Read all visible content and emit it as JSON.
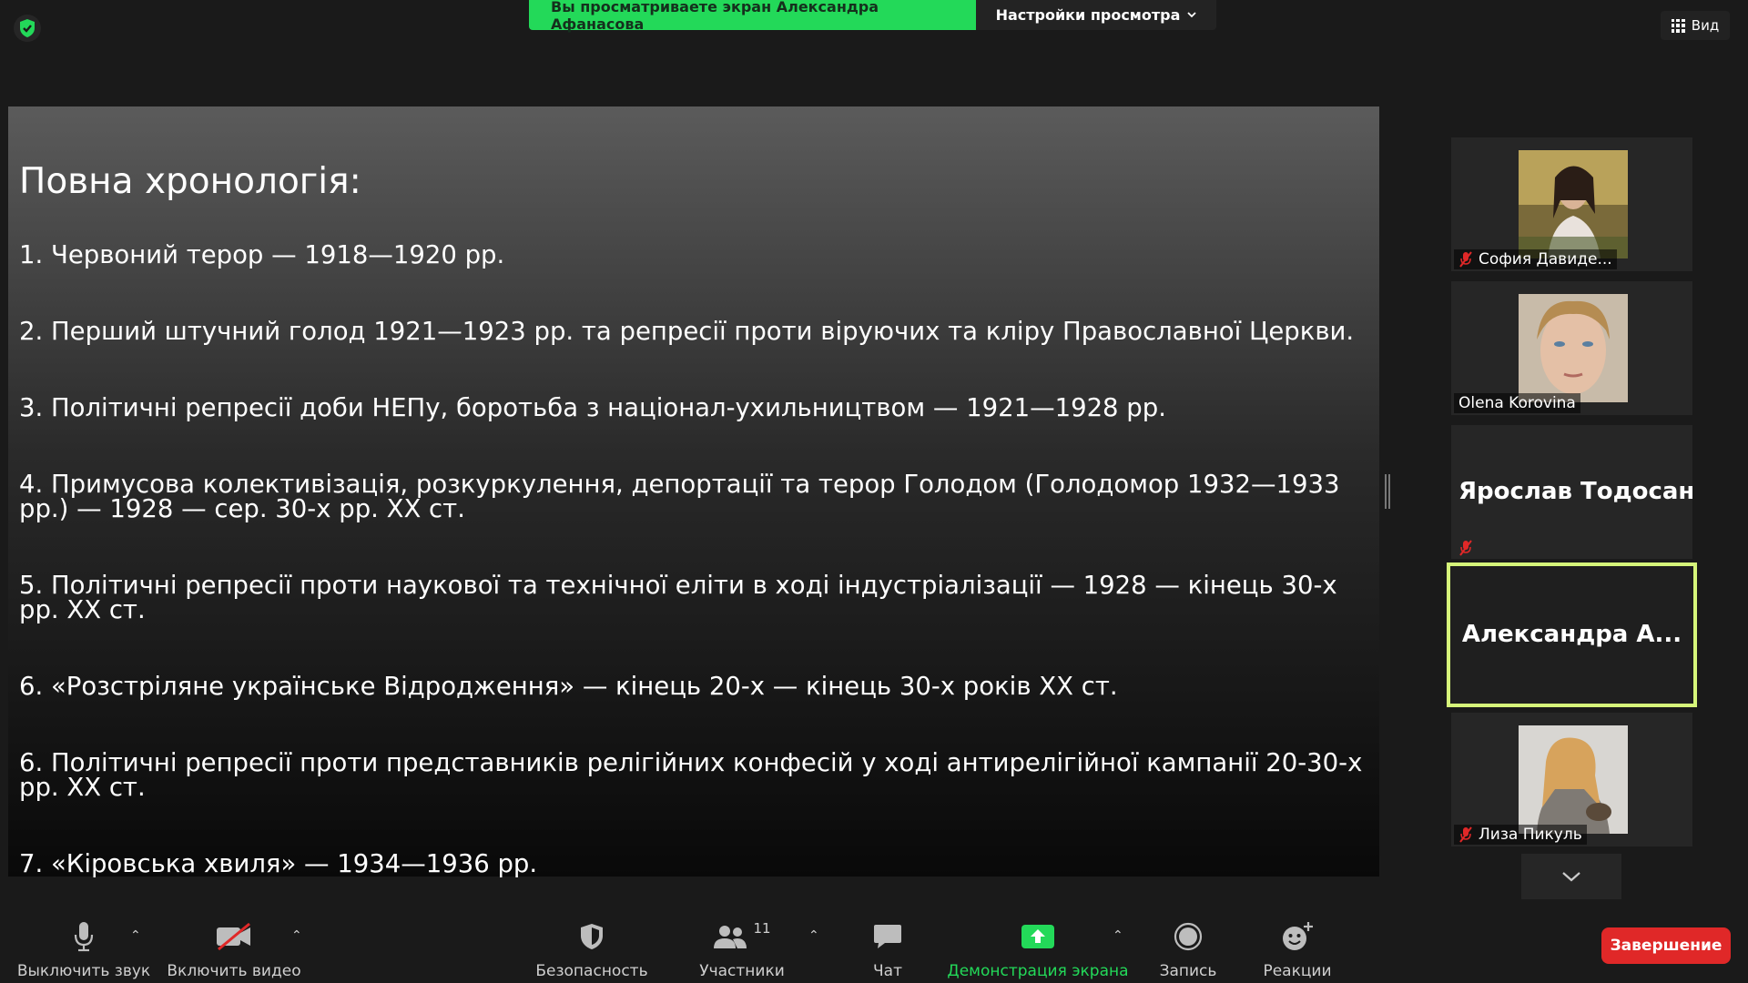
{
  "banner": {
    "viewing_text": "Вы просматриваете экран Александра Афанасова",
    "view_options_label": "Настройки просмотра"
  },
  "view_button": {
    "label": "Вид"
  },
  "slide": {
    "title": "Повна хронологія:",
    "items": [
      "1. Червоний терор — 1918—1920 рр.",
      "2. Перший штучний голод 1921—1923 рр. та репресії проти віруючих та кліру Православної Церкви.",
      "3. Політичні репресії доби НЕПу, боротьба з націонал-ухильництвом — 1921—1928 рр.",
      "4. Примусова колективізація, розкуркулення, депортації та терор Голодом (Голодомор 1932—1933 рр.) — 1928 — сер. 30-х рр. ХХ ст.",
      "5. Політичні репресії проти наукової та технічної еліти в ході індустріалізації — 1928 — кінець 30-х рр. ХХ ст.",
      "6. «Розстріляне українське Відродження» — кінець 20-х — кінець 30-х років ХХ ст.",
      "6. Політичні репресії проти представників релігійних конфесій у ході антирелігійної кампанії 20-30-х рр. ХХ ст.",
      "7. «Кіровська хвиля» — 1934—1936 рр."
    ]
  },
  "participants": [
    {
      "name": "София Давиде...",
      "muted": true,
      "has_video": true
    },
    {
      "name": "Olena Korovina",
      "muted": false,
      "has_video": true
    },
    {
      "name": "Ярослав Тодосан",
      "muted": true,
      "has_video": false
    },
    {
      "name": "Александра  А...",
      "muted": false,
      "has_video": false,
      "active_speaker": true
    },
    {
      "name": "Лиза Пикуль",
      "muted": true,
      "has_video": true
    }
  ],
  "toolbar": {
    "mute_label": "Выключить звук",
    "video_label": "Включить видео",
    "security_label": "Безопасность",
    "participants_label": "Участники",
    "participants_count": "11",
    "chat_label": "Чат",
    "share_label": "Демонстрация экрана",
    "record_label": "Запись",
    "reactions_label": "Реакции",
    "end_label": "Завершение"
  },
  "colors": {
    "accent_green": "#23d959",
    "end_red": "#e02828",
    "active_border": "#d6f57a"
  }
}
